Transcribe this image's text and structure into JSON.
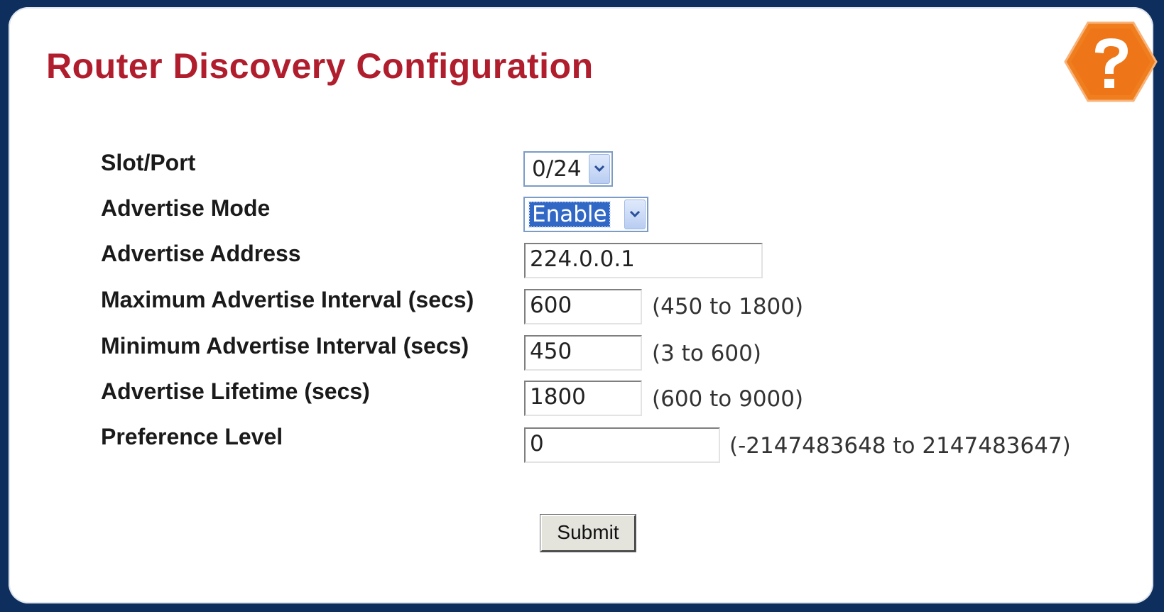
{
  "page": {
    "title": "Router Discovery Configuration",
    "help_icon": "help-question-icon"
  },
  "form": {
    "slot_port": {
      "label": "Slot/Port",
      "value": "0/24"
    },
    "advertise_mode": {
      "label": "Advertise Mode",
      "value": "Enable"
    },
    "advertise_address": {
      "label": "Advertise Address",
      "value": "224.0.0.1"
    },
    "max_interval": {
      "label": "Maximum Advertise Interval (secs)",
      "value": "600",
      "range": "(450 to 1800)"
    },
    "min_interval": {
      "label": "Minimum Advertise Interval (secs)",
      "value": "450",
      "range": "(3 to 600)"
    },
    "lifetime": {
      "label": "Advertise Lifetime (secs)",
      "value": "1800",
      "range": "(600 to 9000)"
    },
    "preference": {
      "label": "Preference Level",
      "value": "0",
      "range": "(-2147483648 to 2147483647)"
    },
    "submit_label": "Submit"
  },
  "colors": {
    "title": "#b01d2d",
    "help_badge": "#f07e1e",
    "frame": "#0e2f5e"
  }
}
